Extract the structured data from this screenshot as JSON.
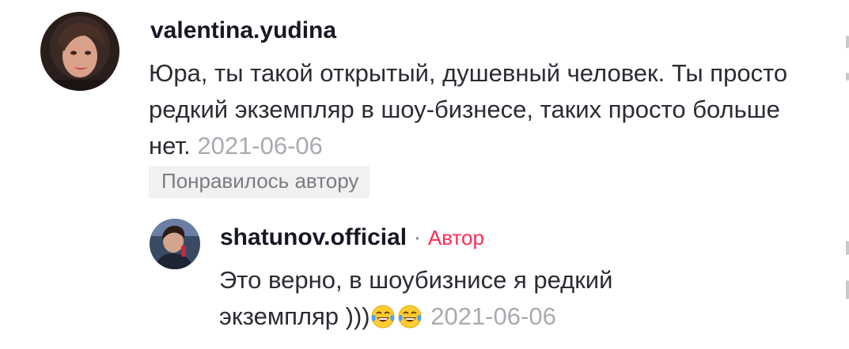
{
  "comments": [
    {
      "username": "valentina.yudina",
      "text": "Юра, ты такой открытый, душевный человек. Ты просто редкий экземпляр в шоу-бизнесе, таких просто больше нет.",
      "date": "2021-06-06",
      "liked_label": "Понравилось автору"
    }
  ],
  "reply": {
    "username": "shatunov.official",
    "separator": "·",
    "badge": "Автор",
    "text": "Это верно, в шоубизнисе я редкий экземпляр )))",
    "emojis": [
      "tears-of-joy-emoji",
      "tears-of-joy-emoji"
    ],
    "date": "2021-06-06"
  },
  "colors": {
    "badge": "#fe2c55",
    "date": "#a9abb1",
    "liked_bg": "#f1f1f2"
  }
}
